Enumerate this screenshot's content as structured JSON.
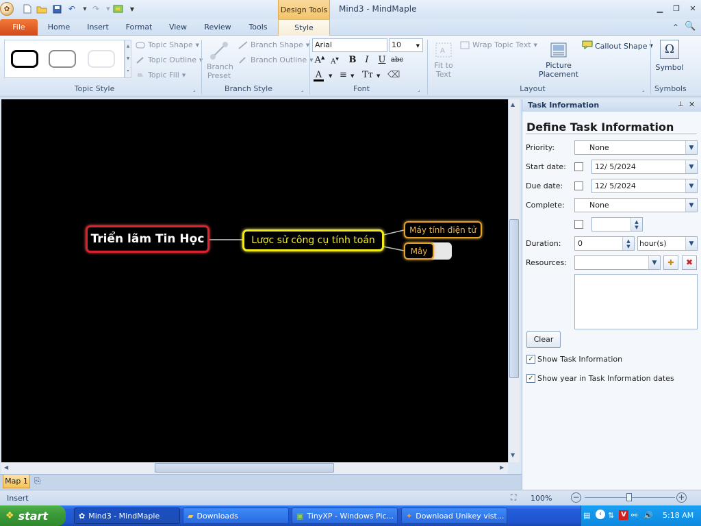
{
  "window": {
    "title": "Mind3 - MindMaple",
    "context_tab_group": "Design Tools"
  },
  "tabs": [
    {
      "label": "File"
    },
    {
      "label": "Home"
    },
    {
      "label": "Insert"
    },
    {
      "label": "Format"
    },
    {
      "label": "View"
    },
    {
      "label": "Review"
    },
    {
      "label": "Tools"
    },
    {
      "label": "Style"
    }
  ],
  "ribbon": {
    "topic_style": {
      "label": "Topic Style",
      "topic_shape": "Topic Shape",
      "topic_outline": "Topic Outline",
      "topic_fill": "Topic Fill"
    },
    "branch_style": {
      "label": "Branch Style",
      "branch_preset_line1": "Branch",
      "branch_preset_line2": "Preset",
      "branch_shape": "Branch Shape",
      "branch_outline": "Branch Outline"
    },
    "font": {
      "label": "Font",
      "family": "Arial",
      "size": "10"
    },
    "layout": {
      "label": "Layout",
      "fit_to_text_line1": "Fit to",
      "fit_to_text_line2": "Text",
      "wrap_topic_text": "Wrap Topic Text",
      "picture_placement_line1": "Picture",
      "picture_placement_line2": "Placement",
      "callout_shape": "Callout Shape"
    },
    "symbols": {
      "label": "Symbols",
      "symbol": "Symbol"
    }
  },
  "mindmap": {
    "central": "Triển lãm Tin Học",
    "main_topic": "Lược sử công cụ tính toán",
    "sub1": "Máy tính điện tử",
    "sub2": "Mây"
  },
  "sheet_tabs": [
    {
      "label": "Map 1"
    }
  ],
  "task_panel": {
    "header": "Task Information",
    "heading": "Define Task Information",
    "priority_label": "Priority:",
    "priority_value": "None",
    "start_label": "Start date:",
    "start_value": "12/  5/2024",
    "due_label": "Due date:",
    "due_value": "12/  5/2024",
    "complete_label": "Complete:",
    "complete_value": "None",
    "duration_label": "Duration:",
    "duration_value": "0",
    "duration_unit": "hour(s)",
    "resources_label": "Resources:",
    "clear_button": "Clear",
    "show_task_info": "Show Task Information",
    "show_year": "Show year in Task Information dates"
  },
  "status": {
    "mode": "Insert",
    "zoom": "100%"
  },
  "taskbar": {
    "start": "start",
    "items": [
      {
        "label": "Mind3 - MindMaple"
      },
      {
        "label": "Downloads"
      },
      {
        "label": "TinyXP - Windows Pic..."
      },
      {
        "label": "Download Unikey vist..."
      }
    ],
    "clock": "5:18 AM"
  },
  "colors": {
    "canvas": "#000000",
    "central_border": "#d9232e",
    "main_border": "#f2ea1a",
    "sub_border": "#e8a22a",
    "file_tab": "#e0581f"
  }
}
